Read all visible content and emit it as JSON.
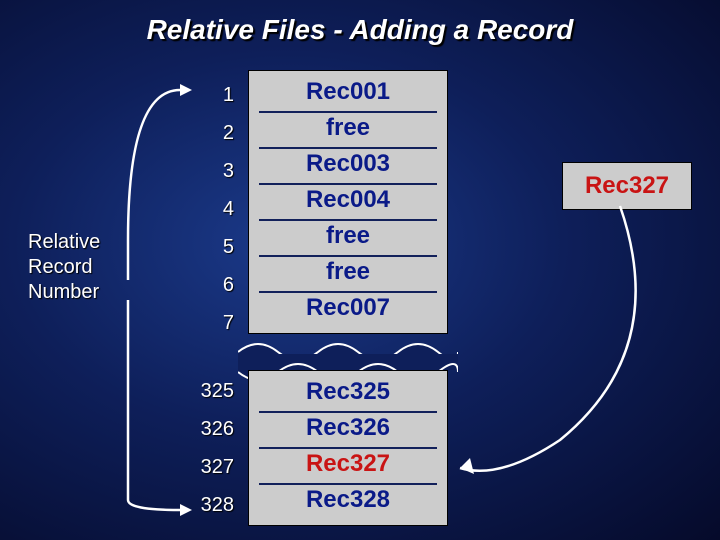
{
  "title": "Relative Files - Adding a Record",
  "side_label_l1": "Relative",
  "side_label_l2": "Record",
  "side_label_l3": "Number",
  "indices_top": [
    "1",
    "2",
    "3",
    "4",
    "5",
    "6",
    "7"
  ],
  "indices_bottom": [
    "325",
    "326",
    "327",
    "328"
  ],
  "records_top": [
    "Rec001",
    "free",
    "Rec003",
    "Rec004",
    "free",
    "free",
    "Rec007"
  ],
  "records_bottom": [
    "Rec325",
    "Rec326",
    "Rec327",
    "Rec328"
  ],
  "insert_record": "Rec327",
  "highlight_index": 2,
  "colors": {
    "highlight": "#c91414",
    "normal": "#0a1a88"
  }
}
